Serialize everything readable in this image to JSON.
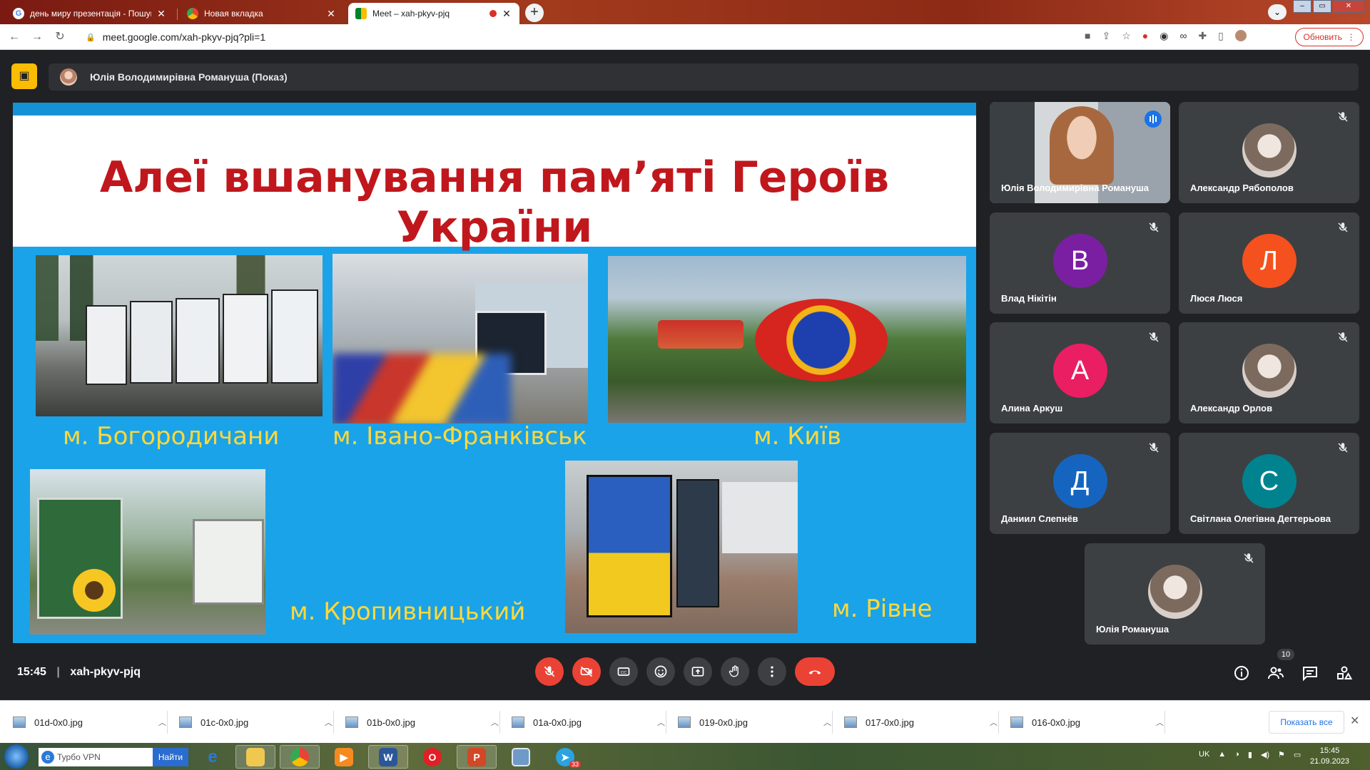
{
  "browser": {
    "tabs": [
      {
        "label": "день миру презентація - Пошук"
      },
      {
        "label": "Новая вкладка"
      },
      {
        "label": "Meet – xah-pkyv-pjq"
      }
    ],
    "url": "meet.google.com/xah-pkyv-pjq?pli=1",
    "update_label": "Обновить"
  },
  "meet": {
    "presenter_label": "Юлія Володимирівна Романуша (Показ)",
    "slide": {
      "title": "Алеї вшанування пам’яті Героїв України",
      "cities": [
        "м. Богородичани",
        "м. Івано-Франківськ",
        "м. Київ",
        "м. Кропивницький",
        "м. Рівне"
      ]
    },
    "participants": [
      {
        "name": "Юлія Володимирівна Романуша",
        "kind": "video",
        "speaking": true
      },
      {
        "name": "Александр Рябополов",
        "kind": "photo",
        "muted": true
      },
      {
        "name": "Влад Нікітін",
        "initial": "В",
        "color": "#7b1fa2",
        "muted": true
      },
      {
        "name": "Люся Люся",
        "initial": "Л",
        "color": "#f4511e",
        "muted": true
      },
      {
        "name": "Алина Аркуш",
        "initial": "А",
        "color": "#e91e63",
        "muted": true
      },
      {
        "name": "Александр Орлов",
        "kind": "photo",
        "muted": true
      },
      {
        "name": "Даниил Слепнёв",
        "initial": "Д",
        "color": "#1565c0",
        "muted": true
      },
      {
        "name": "Світлана Олегівна Дегтерьова",
        "initial": "С",
        "color": "#00838f",
        "muted": true
      },
      {
        "name": "Юлія Романуша",
        "kind": "photo",
        "muted": true
      }
    ],
    "time": "15:45",
    "code": "xah-pkyv-pjq",
    "people_count": "10"
  },
  "downloads": {
    "files": [
      "01d-0x0.jpg",
      "01c-0x0.jpg",
      "01b-0x0.jpg",
      "01a-0x0.jpg",
      "019-0x0.jpg",
      "017-0x0.jpg",
      "016-0x0.jpg"
    ],
    "show_all": "Показать все"
  },
  "taskbar": {
    "search_placeholder": "Турбо VPN",
    "search_button": "Найти",
    "language": "UK",
    "clock_time": "15:45",
    "clock_date": "21.09.2023",
    "telegram_badge": "33"
  }
}
